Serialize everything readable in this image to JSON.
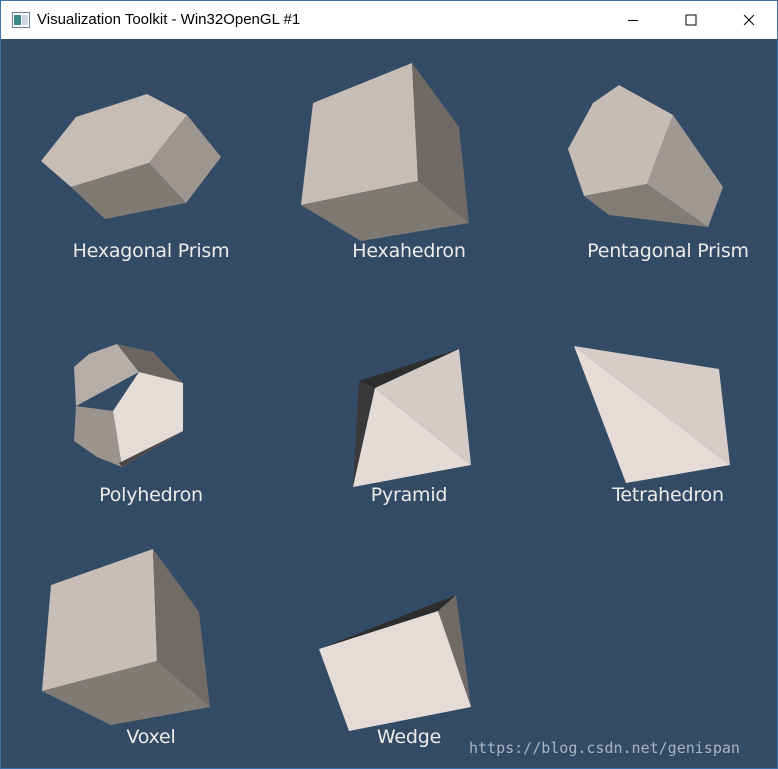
{
  "window": {
    "title": "Visualization Toolkit - Win32OpenGL #1",
    "controls": [
      "minimize-icon",
      "maximize-icon",
      "close-icon"
    ]
  },
  "viewport": {
    "background_color": "#344b66",
    "cells": [
      {
        "label": "Hexagonal Prism",
        "shape": "hexagonal-prism"
      },
      {
        "label": "Hexahedron",
        "shape": "hexahedron"
      },
      {
        "label": "Pentagonal Prism",
        "shape": "pentagonal-prism"
      },
      {
        "label": "Polyhedron",
        "shape": "polyhedron"
      },
      {
        "label": "Pyramid",
        "shape": "pyramid"
      },
      {
        "label": "Tetrahedron",
        "shape": "tetrahedron"
      },
      {
        "label": "Voxel",
        "shape": "voxel"
      },
      {
        "label": "Wedge",
        "shape": "wedge"
      }
    ]
  },
  "watermark": "https://blog.csdn.net/genispan"
}
